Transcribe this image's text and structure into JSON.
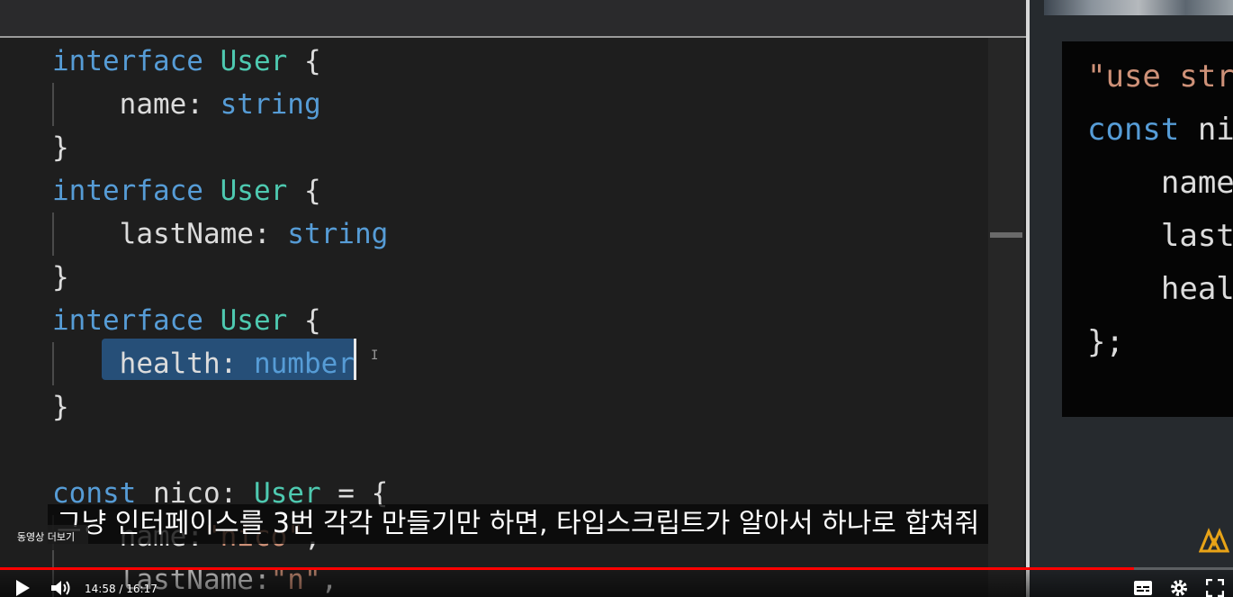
{
  "editor": {
    "lines": [
      [
        {
          "t": "interface ",
          "c": "kw"
        },
        {
          "t": "User",
          "c": "ty"
        },
        {
          "t": " {",
          "c": "id"
        }
      ],
      [
        {
          "t": "    name",
          "c": "id"
        },
        {
          "t": ": ",
          "c": "id"
        },
        {
          "t": "string",
          "c": "kw"
        }
      ],
      [
        {
          "t": "}",
          "c": "id"
        }
      ],
      [
        {
          "t": "interface ",
          "c": "kw"
        },
        {
          "t": "User",
          "c": "ty"
        },
        {
          "t": " {",
          "c": "id"
        }
      ],
      [
        {
          "t": "    lastName",
          "c": "id"
        },
        {
          "t": ": ",
          "c": "id"
        },
        {
          "t": "string",
          "c": "kw"
        }
      ],
      [
        {
          "t": "}",
          "c": "id"
        }
      ],
      [
        {
          "t": "interface ",
          "c": "kw"
        },
        {
          "t": "User",
          "c": "ty"
        },
        {
          "t": " {",
          "c": "id"
        }
      ],
      [
        {
          "t": "    health",
          "c": "id"
        },
        {
          "t": ": ",
          "c": "id"
        },
        {
          "t": "number",
          "c": "kw"
        }
      ],
      [
        {
          "t": "}",
          "c": "id"
        }
      ],
      [
        {
          "t": "",
          "c": "id"
        }
      ],
      [
        {
          "t": "const ",
          "c": "kw"
        },
        {
          "t": "nico",
          "c": "id"
        },
        {
          "t": ": ",
          "c": "id"
        },
        {
          "t": "User",
          "c": "ty"
        },
        {
          "t": " = {",
          "c": "id"
        }
      ],
      [
        {
          "t": "    name",
          "c": "id"
        },
        {
          "t": ":",
          "c": "id"
        },
        {
          "t": "\"nico\"",
          "c": "str"
        },
        {
          "t": ",",
          "c": "id"
        }
      ],
      [
        {
          "t": "    lastName",
          "c": "id"
        },
        {
          "t": ":",
          "c": "id"
        },
        {
          "t": "\"n\"",
          "c": "str"
        },
        {
          "t": ",",
          "c": "id"
        }
      ]
    ]
  },
  "console": {
    "lines": [
      [
        {
          "t": "\"use str",
          "c": "str"
        }
      ],
      [
        {
          "t": "const ",
          "c": "kw"
        },
        {
          "t": "ni",
          "c": "id"
        }
      ],
      [
        {
          "t": "    name",
          "c": "id"
        }
      ],
      [
        {
          "t": "    last",
          "c": "id"
        }
      ],
      [
        {
          "t": "    heal",
          "c": "id"
        }
      ],
      [
        {
          "t": "};",
          "c": "id"
        }
      ]
    ]
  },
  "subtitle": "그냥 인터페이스를 3번 각각 만들기만 하면, 타입스크립트가 알아서 하나로 합쳐줘",
  "more_videos": "동영상 더보기",
  "player": {
    "time": "14:58 / 16:17",
    "progress": 0.92,
    "icons": [
      "play-icon",
      "volume-icon",
      "subtitles-icon",
      "settings-icon",
      "fullscreen-icon"
    ]
  },
  "colors": {
    "keyword": "#569cd6",
    "type": "#4ec9b0",
    "string": "#ce9178",
    "progress": "#ff0000",
    "selection": "#264f78"
  }
}
